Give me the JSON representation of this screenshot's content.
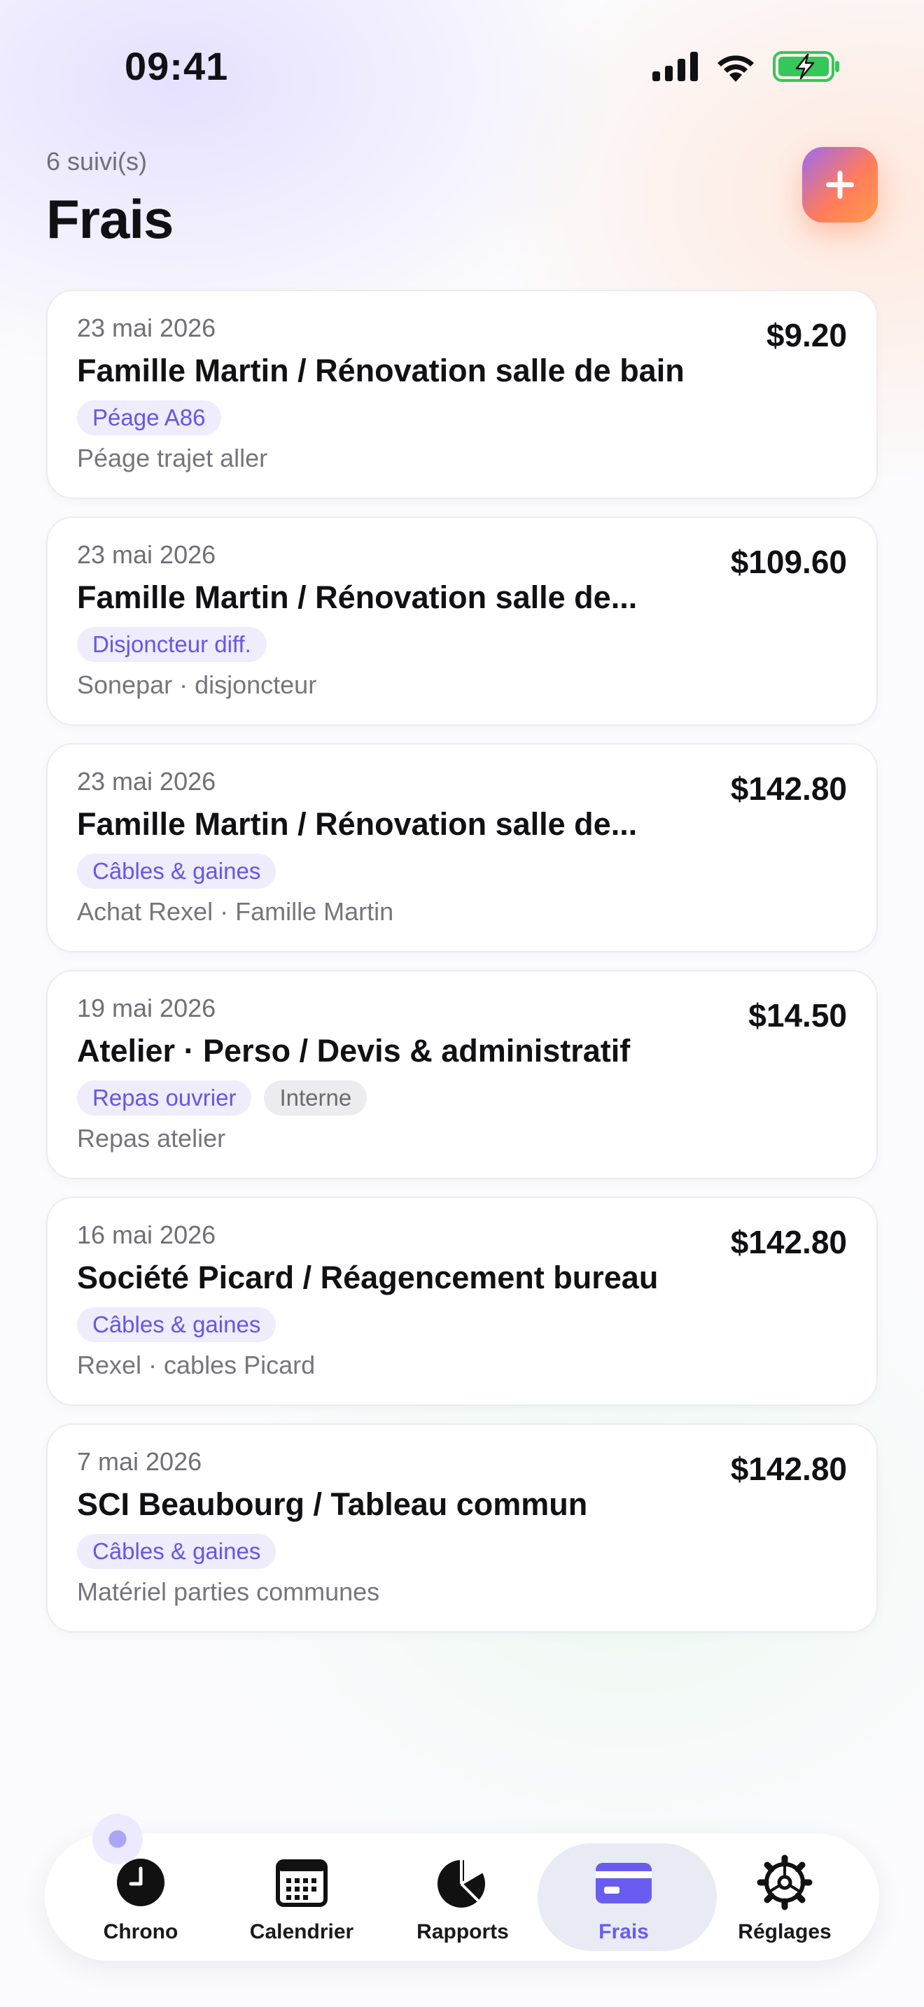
{
  "status_bar": {
    "time": "09:41"
  },
  "header": {
    "subtitle": "6 suivi(s)",
    "title": "Frais"
  },
  "expenses": [
    {
      "date": "23 mai 2026",
      "title": "Famille Martin / Rénovation salle de bain",
      "amount": "$9.20",
      "tags": [
        "Péage A86"
      ],
      "note": "Péage trajet aller"
    },
    {
      "date": "23 mai 2026",
      "title": "Famille Martin / Rénovation salle de...",
      "amount": "$109.60",
      "tags": [
        "Disjoncteur diff."
      ],
      "note": "Sonepar · disjoncteur"
    },
    {
      "date": "23 mai 2026",
      "title": "Famille Martin / Rénovation salle de...",
      "amount": "$142.80",
      "tags": [
        "Câbles & gaines"
      ],
      "note": "Achat Rexel · Famille Martin"
    },
    {
      "date": "19 mai 2026",
      "title": "Atelier · Perso / Devis & administratif",
      "amount": "$14.50",
      "tags": [
        "Repas ouvrier",
        "Interne"
      ],
      "note": "Repas atelier"
    },
    {
      "date": "16 mai 2026",
      "title": "Société Picard / Réagencement bureau",
      "amount": "$142.80",
      "tags": [
        "Câbles & gaines"
      ],
      "note": "Rexel · cables Picard"
    },
    {
      "date": "7 mai 2026",
      "title": "SCI Beaubourg / Tableau commun",
      "amount": "$142.80",
      "tags": [
        "Câbles & gaines"
      ],
      "note": "Matériel parties communes"
    }
  ],
  "tabs": [
    {
      "label": "Chrono",
      "icon": "clock-icon"
    },
    {
      "label": "Calendrier",
      "icon": "calendar-icon"
    },
    {
      "label": "Rapports",
      "icon": "pie-chart-icon"
    },
    {
      "label": "Frais",
      "icon": "credit-card-icon",
      "active": true
    },
    {
      "label": "Réglages",
      "icon": "gear-icon"
    }
  ],
  "colors": {
    "accent": "#6a5cf0",
    "tag_bg": "#eeecfd",
    "add_gradient_start": "#9a6cf2",
    "add_gradient_end": "#ff9a4a",
    "battery": "#34c759"
  }
}
